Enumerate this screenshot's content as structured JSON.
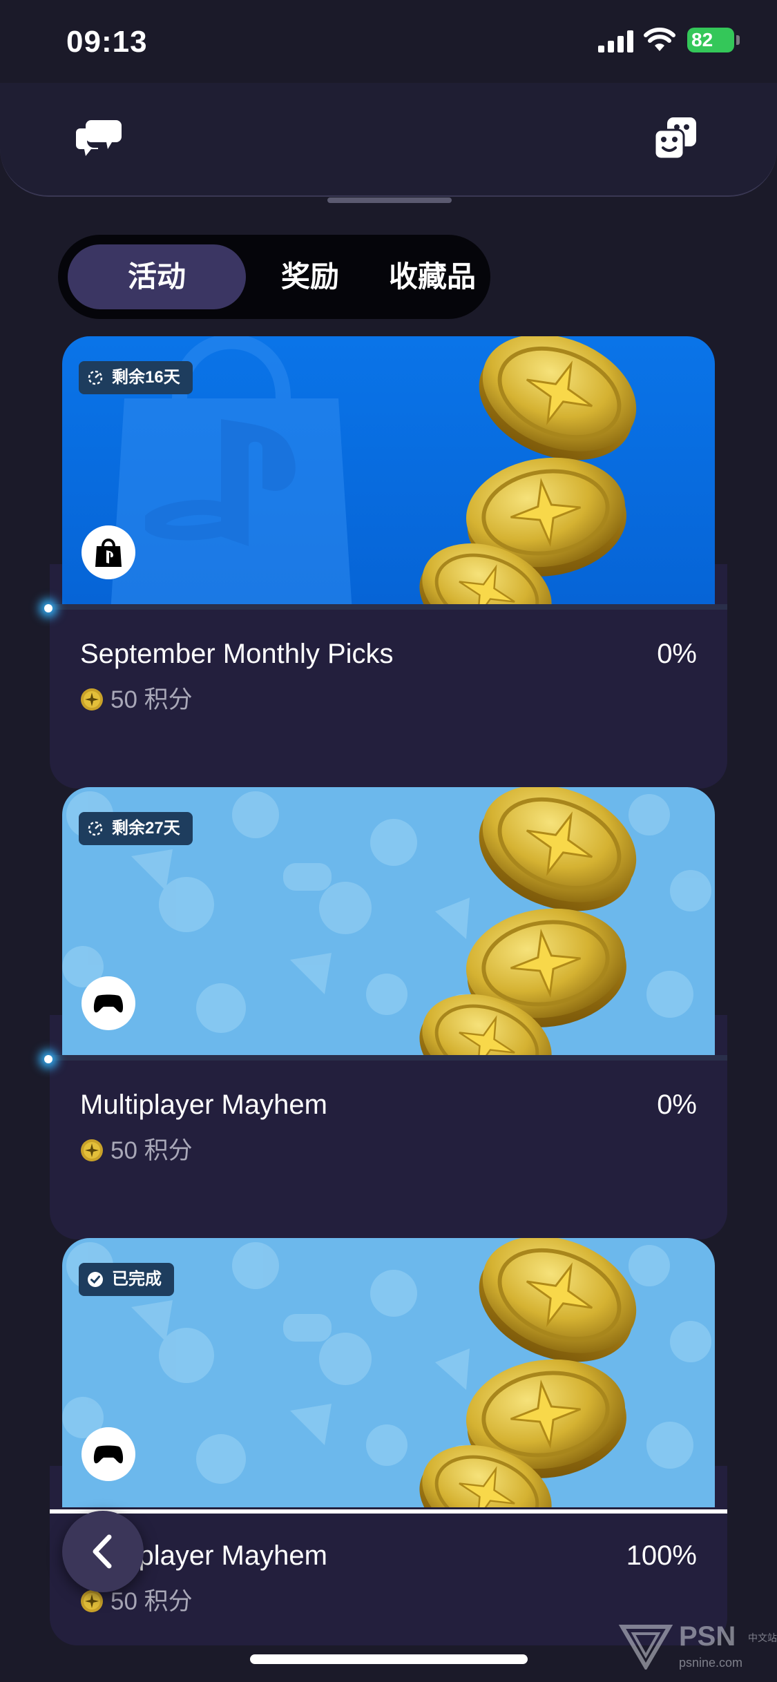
{
  "status_bar": {
    "time": "09:13",
    "battery": "82"
  },
  "header": {
    "left_icon": "chat-bubbles-icon",
    "right_icon": "dice-icon"
  },
  "tabs": [
    {
      "label": "活动",
      "active": true
    },
    {
      "label": "奖励",
      "active": false
    },
    {
      "label": "收藏品",
      "active": false
    }
  ],
  "cards": [
    {
      "badge": "剩余16天",
      "badge_icon": "timer-icon",
      "title": "September Monthly Picks",
      "percent": "0%",
      "points": "50 积分",
      "banner_style": "playstation-store",
      "game_icon": "ps-store-bag-icon"
    },
    {
      "badge": "剩余27天",
      "badge_icon": "timer-icon",
      "title": "Multiplayer Mayhem",
      "percent": "0%",
      "points": "50 积分",
      "banner_style": "light-pattern",
      "game_icon": "controller-icon"
    },
    {
      "badge": "已完成",
      "badge_icon": "check-circle-icon",
      "title": "Multiplayer Mayhem",
      "percent": "100%",
      "points": "50 积分",
      "banner_style": "light-pattern",
      "game_icon": "controller-icon"
    }
  ],
  "watermark": {
    "brand": "PSN",
    "sub": "中文站",
    "domain": "psnine.com"
  },
  "colors": {
    "background": "#1b1a29",
    "active_tab": "#3b3663",
    "card": "#231f3d",
    "coin": "#d8b42c"
  }
}
